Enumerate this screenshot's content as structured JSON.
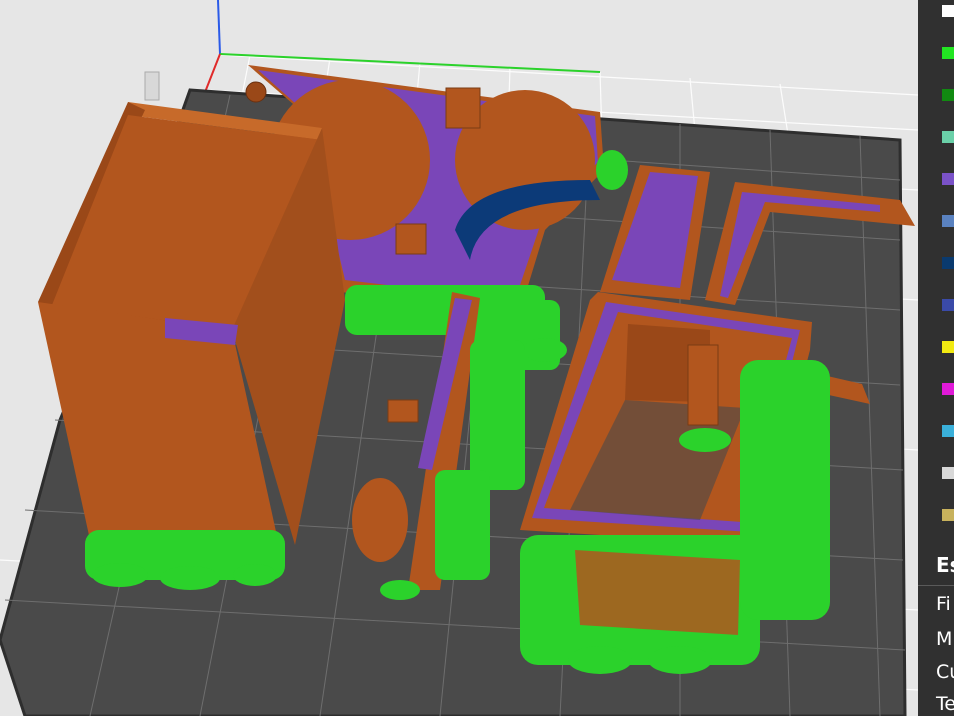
{
  "legend": {
    "items": [
      {
        "name": "legend-white",
        "color": "#ffffff"
      },
      {
        "name": "legend-bright-green",
        "color": "#22e622"
      },
      {
        "name": "legend-dark-green",
        "color": "#118a11"
      },
      {
        "name": "legend-teal",
        "color": "#6ad0a8"
      },
      {
        "name": "legend-purple",
        "color": "#7a52c8"
      },
      {
        "name": "legend-steel-blue",
        "color": "#5a82c0"
      },
      {
        "name": "legend-navy",
        "color": "#0a3a6e"
      },
      {
        "name": "legend-indigo",
        "color": "#3a4aa8"
      },
      {
        "name": "legend-yellow",
        "color": "#f2ea12"
      },
      {
        "name": "legend-magenta",
        "color": "#e01ad8"
      },
      {
        "name": "legend-cyan",
        "color": "#3ab0da"
      },
      {
        "name": "legend-light-gray",
        "color": "#d8d8d8"
      },
      {
        "name": "legend-khaki",
        "color": "#c8b25c"
      }
    ]
  },
  "estimate": {
    "title": "Es",
    "rows": [
      "Fi",
      "M",
      "Cu",
      "Te"
    ]
  },
  "colors": {
    "outer_wall": "#b2561e",
    "top_surface": "#7a46b8",
    "support": "#2bd22b",
    "bridge": "#0c3a78",
    "bed": "#4a4a4a",
    "grid_bg": "#e6e6e6"
  }
}
